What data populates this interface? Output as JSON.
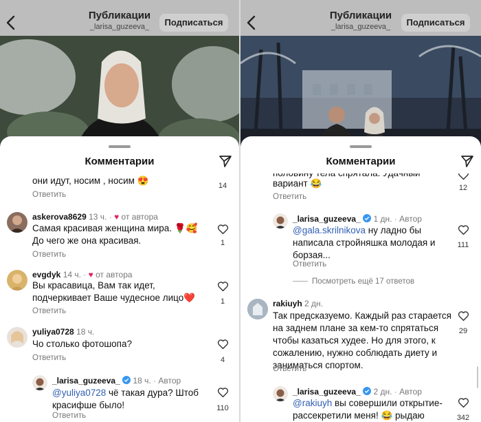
{
  "left": {
    "header": {
      "title": "Публикации",
      "subtitle": "_larisa_guzeeva_",
      "subscribe_label": "Подписаться"
    },
    "sheet_title": "Комментарии",
    "top_snippet": {
      "text": "они идут, носим , носим 😍",
      "reply": "Ответить",
      "likes": "14"
    },
    "comments": [
      {
        "user": "askerova8629",
        "time": "13 ч.",
        "badge": "от автора",
        "text": "Самая красивая женщина мира. 🌹🥰 До чего же она красивая.",
        "reply": "Ответить",
        "likes": "1"
      },
      {
        "user": "evgdyk",
        "time": "14 ч.",
        "badge": "от автора",
        "text": "Вы красавица, Вам так идет, подчеркивает Ваше чудесное лицо❤️",
        "reply": "Ответить",
        "likes": "1"
      },
      {
        "user": "yuliya0728",
        "time": "18 ч.",
        "text": "Чо столько фотошопа?",
        "reply": "Ответить",
        "likes": "4"
      }
    ],
    "author_reply": {
      "user": "_larisa_guzeeva_",
      "time": "18 ч.",
      "badge": "Автор",
      "mention": "@yuliya0728",
      "text": " чё такая дура? Штоб красифше было!",
      "reply": "Ответить",
      "likes": "110"
    }
  },
  "right": {
    "header": {
      "title": "Публикации",
      "subtitle": "_larisa_guzeeva_",
      "subscribe_label": "Подписаться"
    },
    "sheet_title": "Комментарии",
    "top_snippet": {
      "text_line1": "половину тела спрятала. Удачный",
      "text_line2": "вариант 😂",
      "reply": "Ответить",
      "likes": "12"
    },
    "author_reply_1": {
      "user": "_larisa_guzeeva_",
      "time": "1 дн.",
      "badge": "Автор",
      "mention": "@gala.skrilnikova",
      "text": " ну ладно бы написала стройняшка молодая и борзая...",
      "reply": "Ответить",
      "likes": "111"
    },
    "view_more": "Посмотреть ещё 17 ответов",
    "comment": {
      "user": "rakiuyh",
      "time": "2 дн.",
      "text": "Так предсказуемо. Каждый раз старается на заднем плане за кем-то спрятаться чтобы казаться худее. Но для этого, к сожалению, нужно соблюдать диету и заниматься спортом.",
      "reply": "Ответить",
      "likes": "29"
    },
    "author_reply_2": {
      "user": "_larisa_guzeeva_",
      "time": "2 дн.",
      "badge": "Автор",
      "mention": "@rakiuyh",
      "text": " вы совершили открытие- рассекретили меня! 😂 рыдаю",
      "likes": "342"
    }
  },
  "colors": {
    "mention": "#2f5fb3",
    "heart_red": "#e0245e",
    "verified": "#3897f0",
    "header_bg": "#bdbdbd"
  },
  "icons": [
    "back-arrow-icon",
    "share-icon",
    "heart-icon",
    "verified-icon"
  ]
}
